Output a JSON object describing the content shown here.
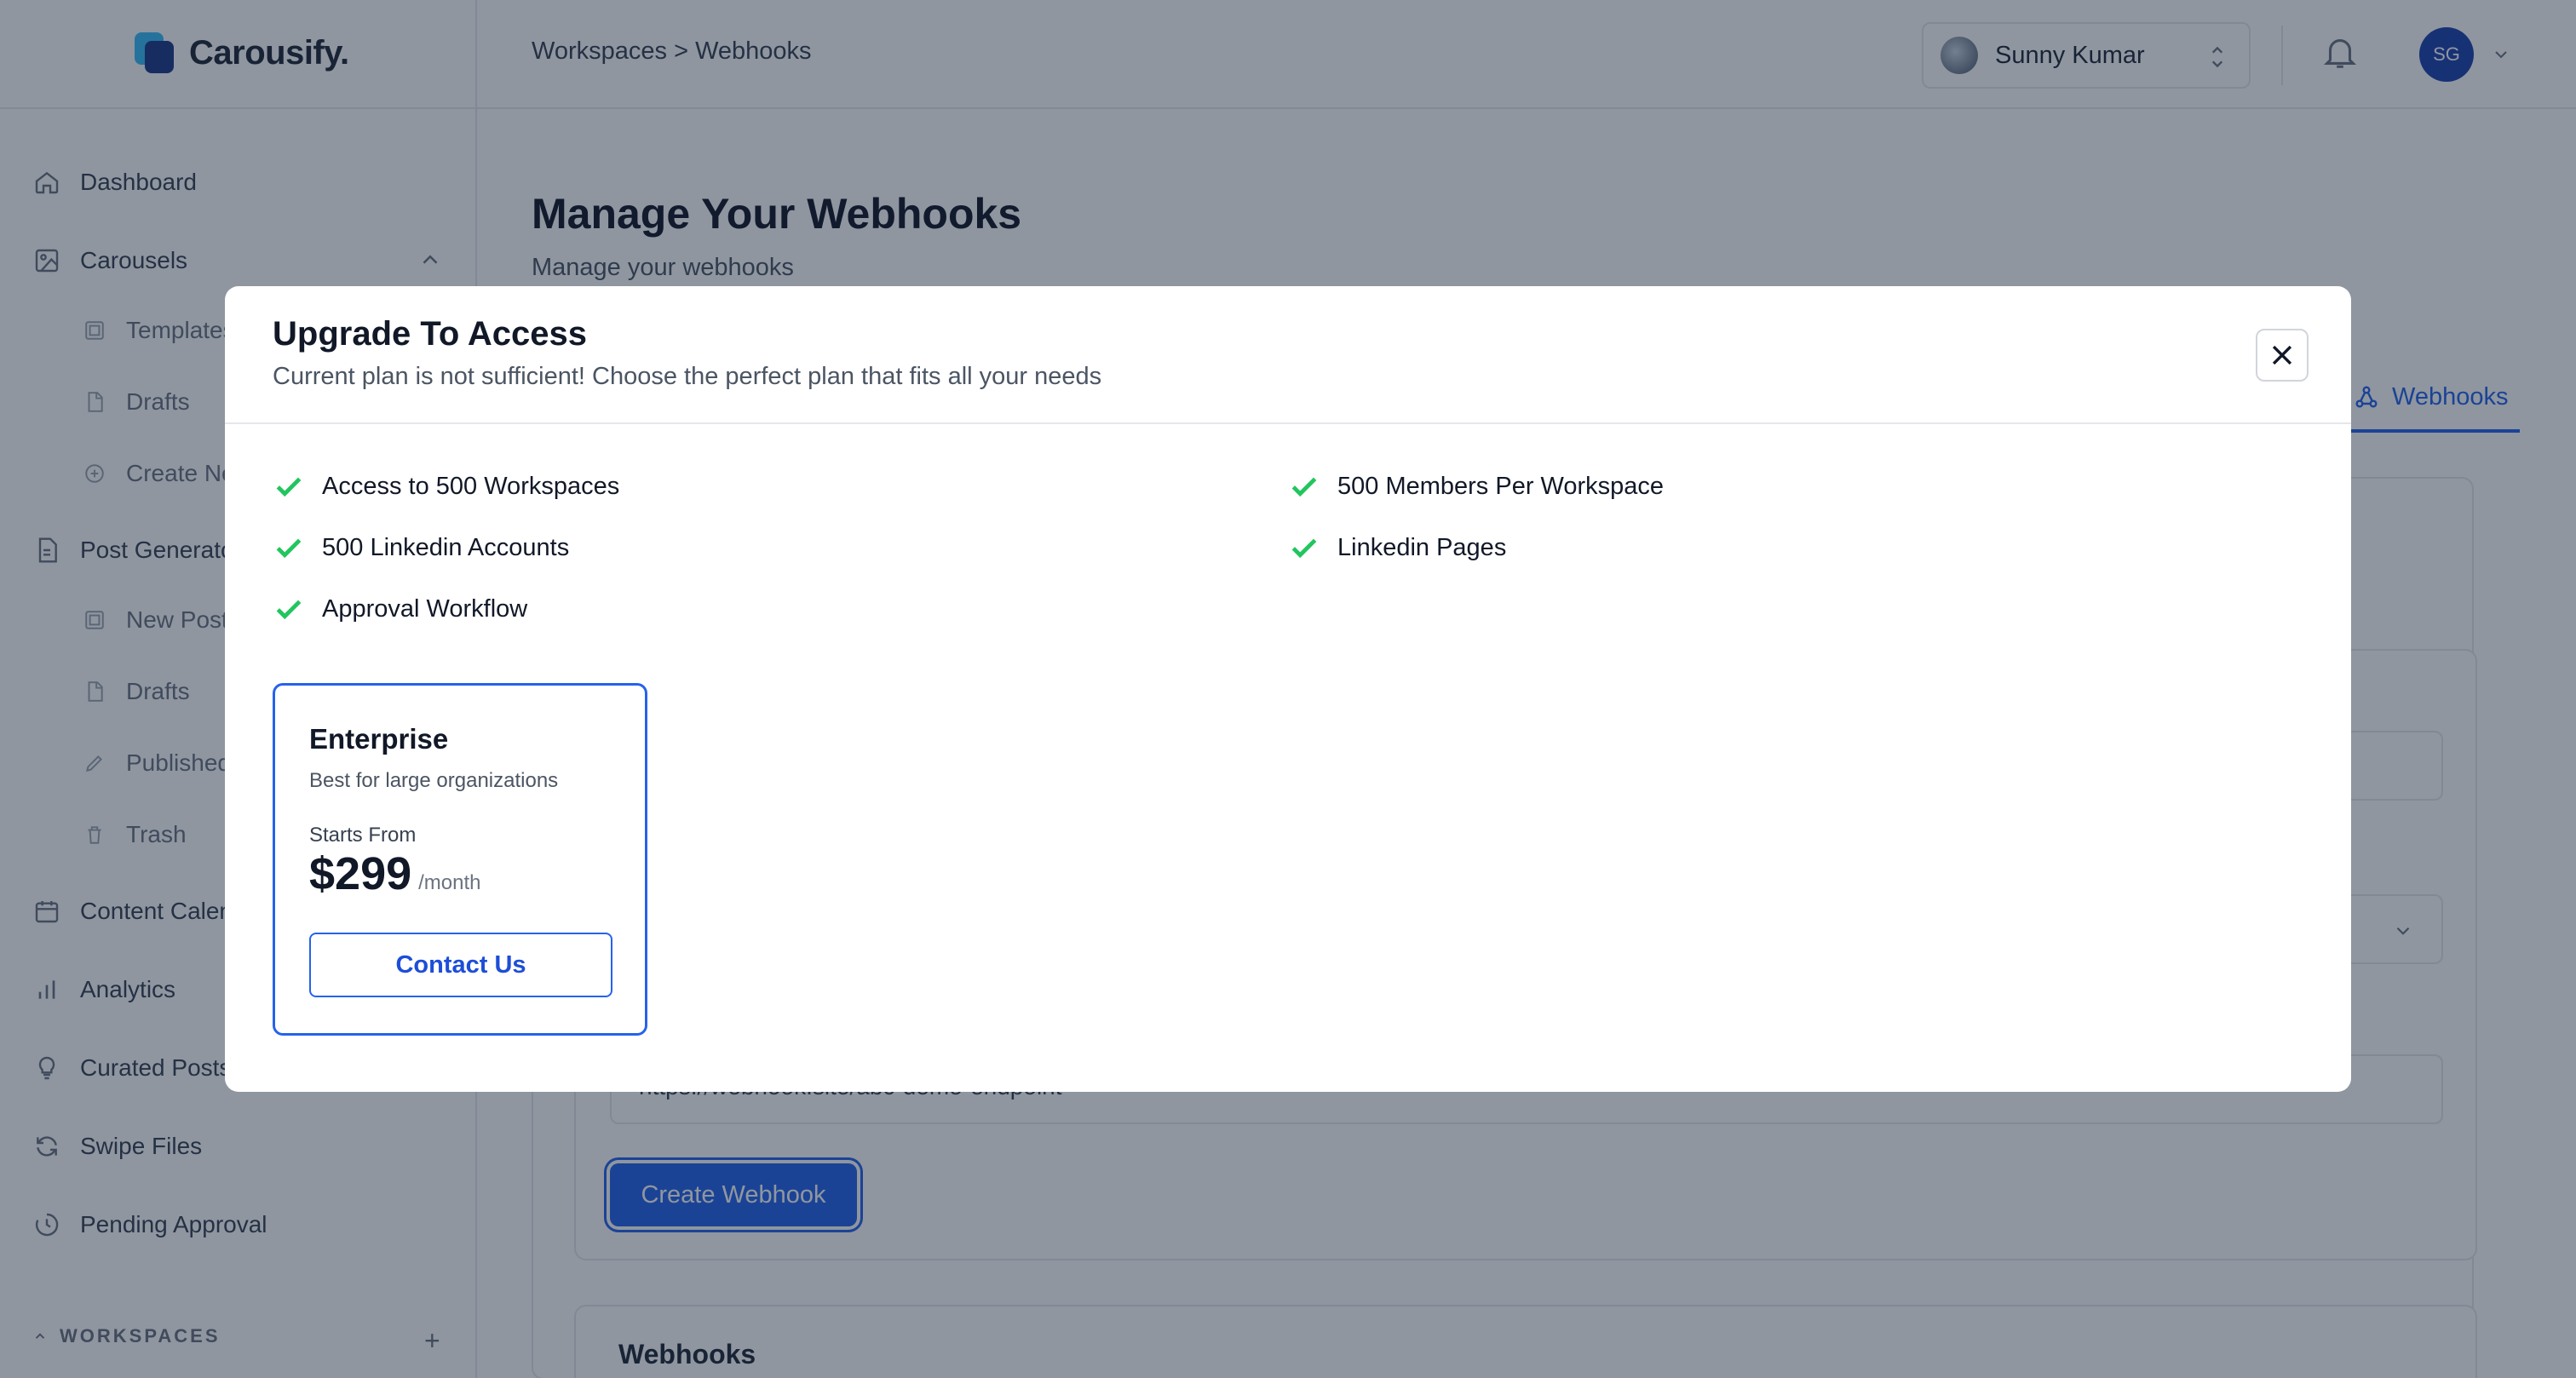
{
  "app": {
    "name": "Carousify."
  },
  "sidebar": {
    "items": [
      {
        "label": "Dashboard",
        "icon": "home-icon"
      },
      {
        "label": "Carousels",
        "icon": "image-icon"
      },
      {
        "label": "Templates",
        "icon": "template-icon"
      },
      {
        "label": "Drafts",
        "icon": "file-icon"
      },
      {
        "label": "Create New",
        "icon": "plus-circle-icon"
      },
      {
        "label": "Post Generator",
        "icon": "document-icon"
      },
      {
        "label": "New Post",
        "icon": "template-icon"
      },
      {
        "label": "Drafts",
        "icon": "file-icon"
      },
      {
        "label": "Published",
        "icon": "pencil-icon"
      },
      {
        "label": "Trash",
        "icon": "trash-icon"
      },
      {
        "label": "Content Calendar",
        "icon": "calendar-icon"
      },
      {
        "label": "Analytics",
        "icon": "bar-chart-icon"
      },
      {
        "label": "Curated Posts",
        "icon": "lightbulb-icon"
      },
      {
        "label": "Swipe Files",
        "icon": "refresh-icon"
      },
      {
        "label": "Pending Approval",
        "icon": "clock-icon"
      }
    ],
    "workspaces_label": "WORKSPACES"
  },
  "header": {
    "breadcrumb": "Workspaces > Webhooks",
    "user_name": "Sunny Kumar",
    "avatar_initials": "SG"
  },
  "main": {
    "title": "Manage Your Webhooks",
    "subtitle": "Manage your webhooks",
    "active_tab": "Webhooks",
    "endpoint_value": "https://webhook.site/abc-demo-endpoint",
    "create_button": "Create Webhook",
    "webhooks_section_title": "Webhooks"
  },
  "modal": {
    "title": "Upgrade To Access",
    "subtitle": "Current plan is not sufficient! Choose the perfect plan that fits all your needs",
    "features": [
      "Access to 500 Workspaces",
      "500 Linkedin Accounts",
      "Approval Workflow",
      "500 Members Per Workspace",
      "Linkedin Pages"
    ],
    "plan": {
      "name": "Enterprise",
      "description": "Best for large organizations",
      "starts_from": "Starts From",
      "price": "$299",
      "period": "/month",
      "cta": "Contact Us"
    }
  },
  "colors": {
    "accent": "#2563eb",
    "check": "#22c55e",
    "overlay": "rgba(17,32,54,0.47)"
  }
}
